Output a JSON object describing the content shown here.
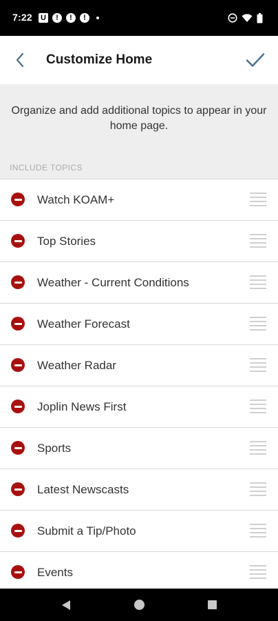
{
  "status_bar": {
    "time": "7:22",
    "left_icons": [
      "u-app-icon",
      "alert-icon",
      "alert-icon",
      "alert-icon",
      "dot-icon"
    ],
    "right_icons": [
      "do-not-disturb-icon",
      "wifi-icon",
      "battery-icon"
    ]
  },
  "header": {
    "title": "Customize Home",
    "back_icon": "chevron-left-icon",
    "confirm_icon": "checkmark-icon"
  },
  "intro": {
    "text": "Organize and add additional topics to appear in your home page."
  },
  "section": {
    "label": "INCLUDE TOPICS"
  },
  "topics": [
    {
      "label": "Watch KOAM+"
    },
    {
      "label": "Top Stories"
    },
    {
      "label": "Weather - Current Conditions"
    },
    {
      "label": "Weather Forecast"
    },
    {
      "label": "Weather Radar"
    },
    {
      "label": "Joplin News First"
    },
    {
      "label": "Sports"
    },
    {
      "label": "Latest Newscasts"
    },
    {
      "label": "Submit a Tip/Photo"
    },
    {
      "label": "Events"
    }
  ],
  "colors": {
    "accent": "#4a6e8e",
    "remove": "#a8100f",
    "intro_background": "#eeeeee"
  },
  "nav_bar": {
    "icons": [
      "nav-back-icon",
      "nav-home-icon",
      "nav-recents-icon"
    ]
  }
}
